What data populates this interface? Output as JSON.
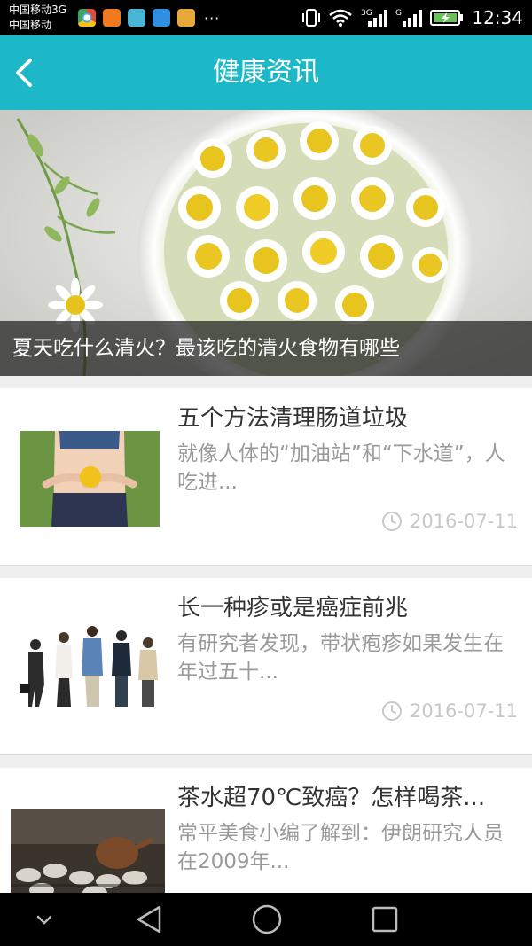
{
  "status_bar": {
    "carrier_1": "中国移动3G",
    "carrier_2": "中国移动",
    "more": "···",
    "time": "12:34"
  },
  "header": {
    "title": "健康资讯"
  },
  "banner": {
    "caption": "夏天吃什么清火？最该吃的清火食物有哪些"
  },
  "articles": [
    {
      "title": "五个方法清理肠道垃圾",
      "summary": "就像人体的“加油站”和“下水道”，人吃进...",
      "date": "2016-07-11"
    },
    {
      "title": "长一种疹或是癌症前兆",
      "summary": "有研究者发现，带状疱疹如果发生在年过五十...",
      "date": "2016-07-11"
    },
    {
      "title": "茶水超70℃致癌？怎样喝茶...",
      "summary": "常平美食小编了解到：伊朗研究人员在2009年...",
      "date": ""
    }
  ],
  "colors": {
    "accent": "#1db8c8",
    "title_text": "#333333",
    "summary_text": "#9a9a9a",
    "date_text": "#c8c8c8"
  }
}
